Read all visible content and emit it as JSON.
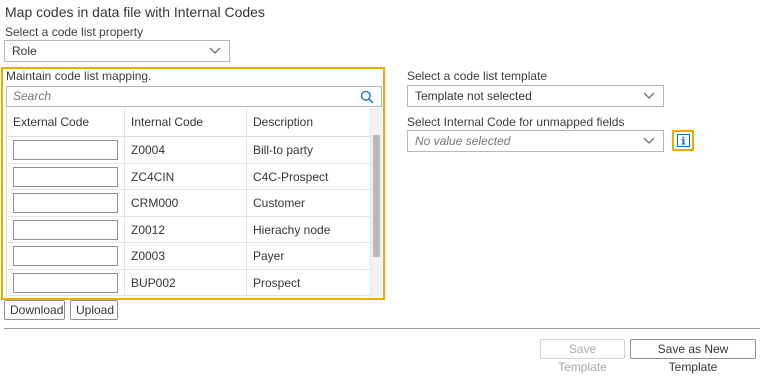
{
  "page": {
    "title": "Map codes in data file with Internal Codes"
  },
  "property": {
    "label": "Select a code list property",
    "value": "Role"
  },
  "mapping": {
    "label": "Maintain code list mapping.",
    "search_placeholder": "Search",
    "columns": [
      "External Code",
      "Internal Code",
      "Description"
    ],
    "rows": [
      {
        "external": "",
        "internal": "Z0004",
        "description": "Bill-to party"
      },
      {
        "external": "",
        "internal": "ZC4CIN",
        "description": "C4C-Prospect"
      },
      {
        "external": "",
        "internal": "CRM000",
        "description": "Customer"
      },
      {
        "external": "",
        "internal": "Z0012",
        "description": "Hierachy node"
      },
      {
        "external": "",
        "internal": "Z0003",
        "description": "Payer"
      },
      {
        "external": "",
        "internal": "BUP002",
        "description": "Prospect"
      }
    ]
  },
  "template": {
    "label": "Select a code list template",
    "value": "Template not selected"
  },
  "unmapped": {
    "label": "Select Internal Code for unmapped fields",
    "placeholder": "No value selected"
  },
  "buttons": {
    "download": "Download",
    "upload": "Upload",
    "save_template": "Save Template",
    "save_new_template": "Save as New Template"
  },
  "icons": {
    "dropdown": "chevron-down-icon",
    "search": "search-icon",
    "info": "info-icon"
  },
  "colors": {
    "highlight": "#f0ab00",
    "accent": "#0a6ed1"
  }
}
